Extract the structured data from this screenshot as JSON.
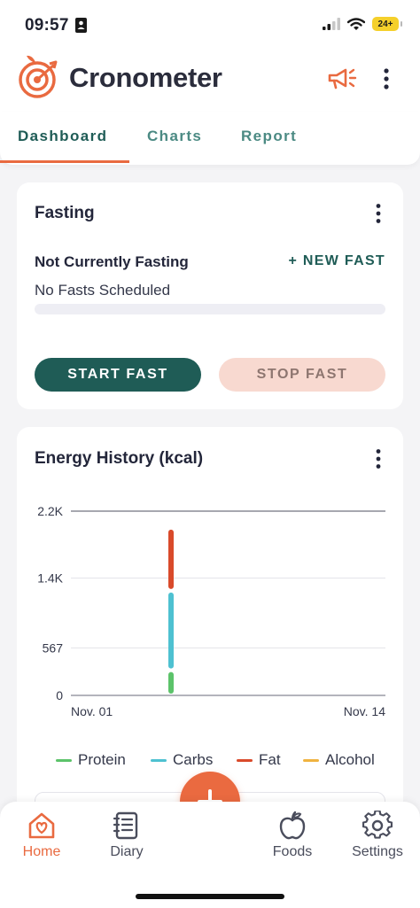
{
  "status_bar": {
    "time": "09:57",
    "battery": "24+"
  },
  "header": {
    "app_title": "Cronometer"
  },
  "tabs": [
    {
      "label": "Dashboard"
    },
    {
      "label": "Charts"
    },
    {
      "label": "Report"
    }
  ],
  "fasting_card": {
    "title": "Fasting",
    "status": "Not Currently Fasting",
    "new_fast_label": "+ NEW FAST",
    "schedule": "No Fasts Scheduled",
    "progress": 0,
    "start_label": "START FAST",
    "stop_label": "STOP FAST"
  },
  "energy_card": {
    "title": "Energy History (kcal)"
  },
  "colors": {
    "accent": "#e96a40",
    "primary": "#1f5c56",
    "protein": "#5cc36a",
    "carbs": "#4ec1d1",
    "fat": "#d94a2b",
    "alcohol": "#f0b340"
  },
  "chart_data": {
    "type": "bar",
    "title": "Energy History (kcal)",
    "y_ticks": [
      "2.2K",
      "1.4K",
      "567",
      "0"
    ],
    "y_tick_values": [
      2200,
      1400,
      567,
      0
    ],
    "ylim": [
      0,
      2200
    ],
    "x_tick_labels": [
      "Nov. 01",
      "Nov. 14"
    ],
    "stacked": true,
    "grid": true,
    "legend_position": "bottom",
    "x": [
      "Nov. 06"
    ],
    "series": [
      {
        "name": "Protein",
        "values": [
          300
        ]
      },
      {
        "name": "Carbs",
        "values": [
          950
        ]
      },
      {
        "name": "Fat",
        "values": [
          750
        ]
      },
      {
        "name": "Alcohol",
        "values": [
          0
        ]
      }
    ]
  },
  "bottom_nav": {
    "items": [
      {
        "label": "Home",
        "icon": "home-icon"
      },
      {
        "label": "Diary",
        "icon": "diary-icon"
      },
      {
        "label": "Foods",
        "icon": "apple-icon"
      },
      {
        "label": "Settings",
        "icon": "gear-icon"
      }
    ],
    "fab_icon": "plus-icon"
  }
}
